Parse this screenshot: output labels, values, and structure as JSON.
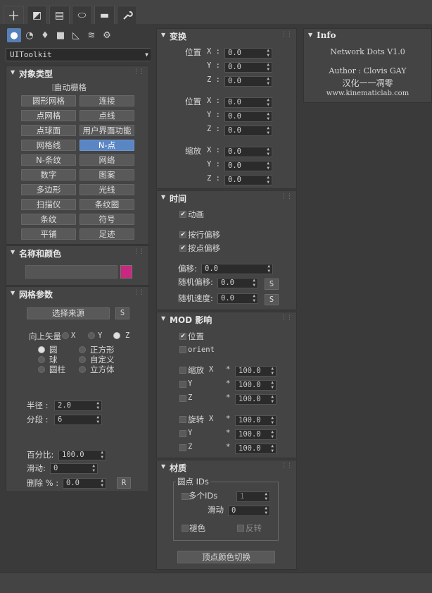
{
  "tabs": [
    {
      "name": "create-tab",
      "icon": "plus-icon",
      "glyph": "＋"
    },
    {
      "name": "modify-tab",
      "icon": "modify-icon",
      "glyph": "◩"
    },
    {
      "name": "hierarchy-tab",
      "icon": "hierarchy-icon",
      "glyph": "▤"
    },
    {
      "name": "motion-tab",
      "icon": "motion-icon",
      "glyph": "⬭"
    },
    {
      "name": "display-tab",
      "icon": "display-icon",
      "glyph": "▬"
    },
    {
      "name": "utilities-tab",
      "icon": "wrench-icon",
      "glyph": "✎"
    }
  ],
  "categories": [
    {
      "icon": "geometry-icon",
      "glyph": "●"
    },
    {
      "icon": "shapes-icon",
      "glyph": "◔"
    },
    {
      "icon": "lights-icon",
      "glyph": "♦"
    },
    {
      "icon": "cameras-icon",
      "glyph": "■"
    },
    {
      "icon": "helpers-icon",
      "glyph": "◺"
    },
    {
      "icon": "spacewarps-icon",
      "glyph": "≋"
    },
    {
      "icon": "systems-icon",
      "glyph": "⚙"
    }
  ],
  "dropdown": {
    "value": "UIToolkit"
  },
  "object_type": {
    "title": "对象类型",
    "autogrid": "自动栅格",
    "buttons": [
      [
        "圆形网格",
        "连接"
      ],
      [
        "点网格",
        "点线"
      ],
      [
        "点球面",
        "用户界面功能"
      ],
      [
        "网格线",
        "N-点"
      ],
      [
        "N-条纹",
        "网络"
      ],
      [
        "数字",
        "图案"
      ],
      [
        "多边形",
        "光线"
      ],
      [
        "扫描仪",
        "条纹圈"
      ],
      [
        "条纹",
        "符号"
      ],
      [
        "平铺",
        "足迹"
      ]
    ],
    "selected": "N-点"
  },
  "name_color": {
    "title": "名称和颜色",
    "name_value": "",
    "color": "#c8287f"
  },
  "grid_params": {
    "title": "网格参数",
    "pick_source": "选择来源",
    "s_button": "S",
    "up_vector": "向上矢量",
    "axes": [
      "X",
      "Y",
      "Z"
    ],
    "selected_axis": "Z",
    "shapes_left": [
      "圆",
      "球",
      "圆柱"
    ],
    "shapes_right": [
      "正方形",
      "自定义",
      "立方体"
    ],
    "selected_shape": "圆",
    "radius_label": "半径 :",
    "radius_value": "2.0",
    "segments_label": "分段 :",
    "segments_value": "6",
    "percent_label": "百分比:",
    "percent_value": "100.0",
    "slide_label": "滑动:",
    "slide_value": "0",
    "delete_label": "删除 % :",
    "delete_value": "0.0",
    "r_button": "R"
  },
  "transform": {
    "title": "变换",
    "groups": [
      {
        "label": "位置",
        "rows": [
          [
            "X :",
            "0.0"
          ],
          [
            "Y :",
            "0.0"
          ],
          [
            "Z :",
            "0.0"
          ]
        ]
      },
      {
        "label": "位置",
        "rows": [
          [
            "X :",
            "0.0"
          ],
          [
            "Y :",
            "0.0"
          ],
          [
            "Z :",
            "0.0"
          ]
        ]
      },
      {
        "label": "缩放",
        "rows": [
          [
            "X :",
            "0.0"
          ],
          [
            "Y :",
            "0.0"
          ],
          [
            "Z :",
            "0.0"
          ]
        ]
      }
    ]
  },
  "time": {
    "title": "时间",
    "animate": "动画",
    "row_offset": "按行偏移",
    "point_offset": "按点偏移",
    "offset_label": "偏移:",
    "offset_value": "0.0",
    "rand_offset_label": "随机偏移:",
    "rand_offset_value": "0.0",
    "rand_speed_label": "随机速度:",
    "rand_speed_value": "0.0",
    "s_button": "S"
  },
  "mod": {
    "title": "MOD 影响",
    "position": "位置",
    "orient": "orient",
    "scale_label": "缩放",
    "rotate_label": "旋转",
    "x": "X",
    "y": "Y",
    "z": "Z",
    "mult": "*",
    "value": "100.0"
  },
  "material": {
    "title": "材质",
    "group": "圆点 IDs",
    "multi_ids": "多个IDs",
    "multi_value": "1",
    "slide_label": "滑动",
    "slide_value": "0",
    "fade": "褪色",
    "invert": "反转",
    "toggle_button": "顶点颜色切换"
  },
  "info": {
    "title": "Info",
    "line1": "Network Dots V1.0",
    "line2": "Author : Clovis GAY",
    "line3": "汉化一一凋零",
    "line4": "www.kinematiclab.com"
  }
}
